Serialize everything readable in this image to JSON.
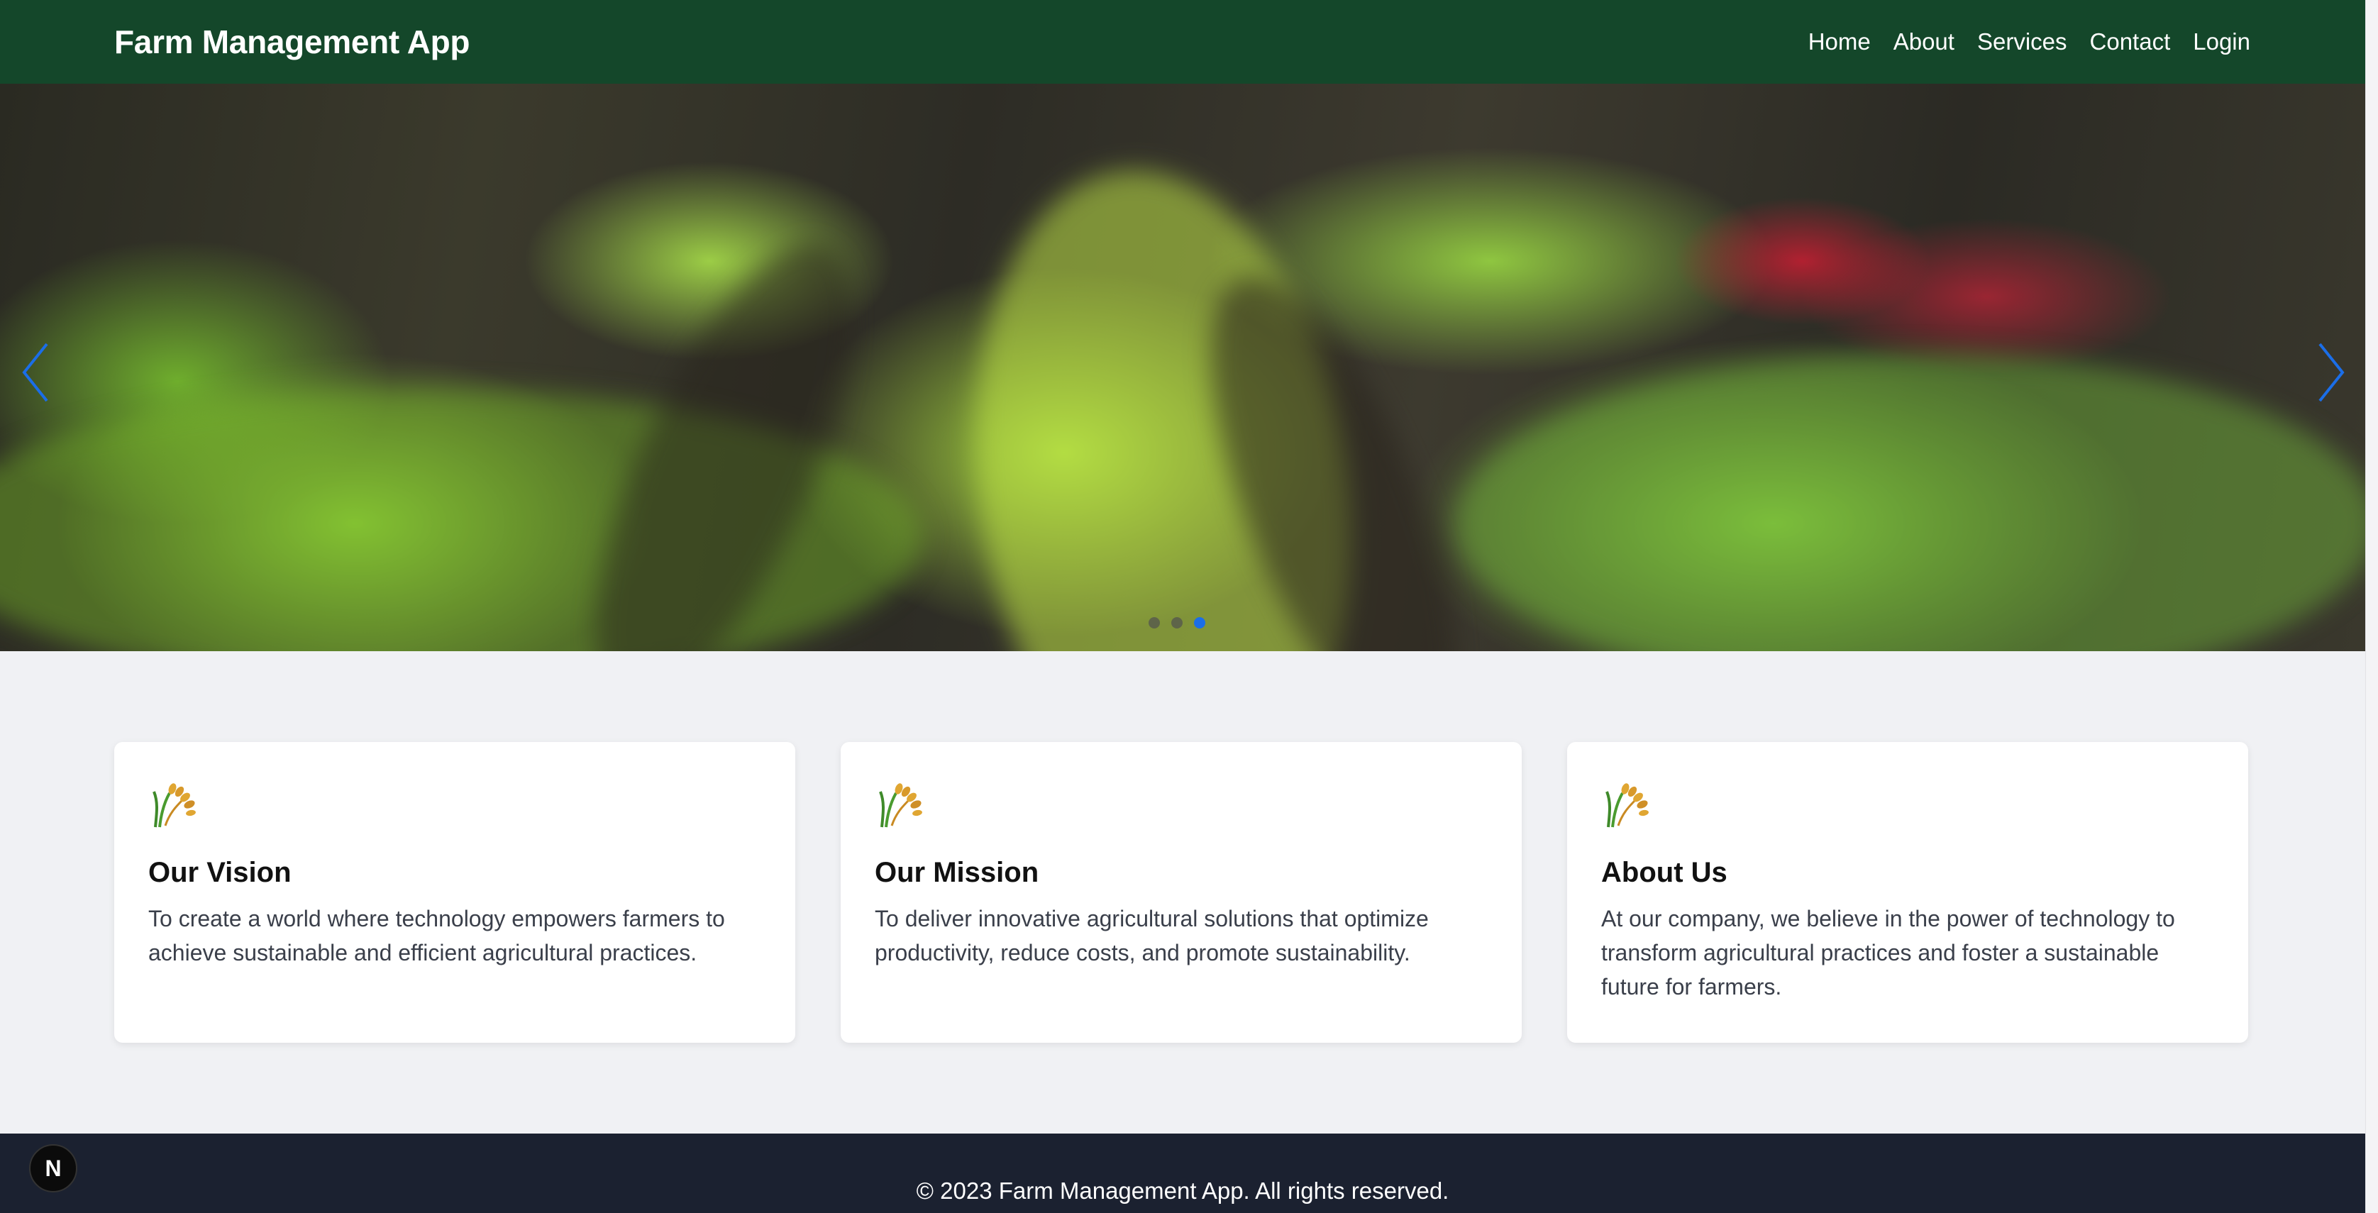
{
  "nav": {
    "brand": "Farm Management App",
    "links": [
      {
        "label": "Home"
      },
      {
        "label": "About"
      },
      {
        "label": "Services"
      },
      {
        "label": "Contact"
      },
      {
        "label": "Login"
      }
    ]
  },
  "hero": {
    "prev_icon": "chevron-left-icon",
    "next_icon": "chevron-right-icon",
    "slides_total": 3,
    "active_slide": 3,
    "accent": "#1b6ee8"
  },
  "cards": [
    {
      "icon": "rice-plant-icon",
      "title": "Our Vision",
      "text": "To create a world where technology empowers farmers to achieve sustainable and efficient agricultural practices."
    },
    {
      "icon": "rice-plant-icon",
      "title": "Our Mission",
      "text": "To deliver innovative agricultural solutions that optimize productivity, reduce costs, and promote sustainability."
    },
    {
      "icon": "rice-plant-icon",
      "title": "About Us",
      "text": "At our company, we believe in the power of technology to transform agricultural practices and foster a sustainable future for farmers."
    }
  ],
  "footer": {
    "text": "© 2023 Farm Management App. All rights reserved.",
    "dev_badge": "N"
  },
  "colors": {
    "navbar": "#14472a",
    "footer": "#1b2130",
    "page_bg": "#f0f1f4"
  }
}
